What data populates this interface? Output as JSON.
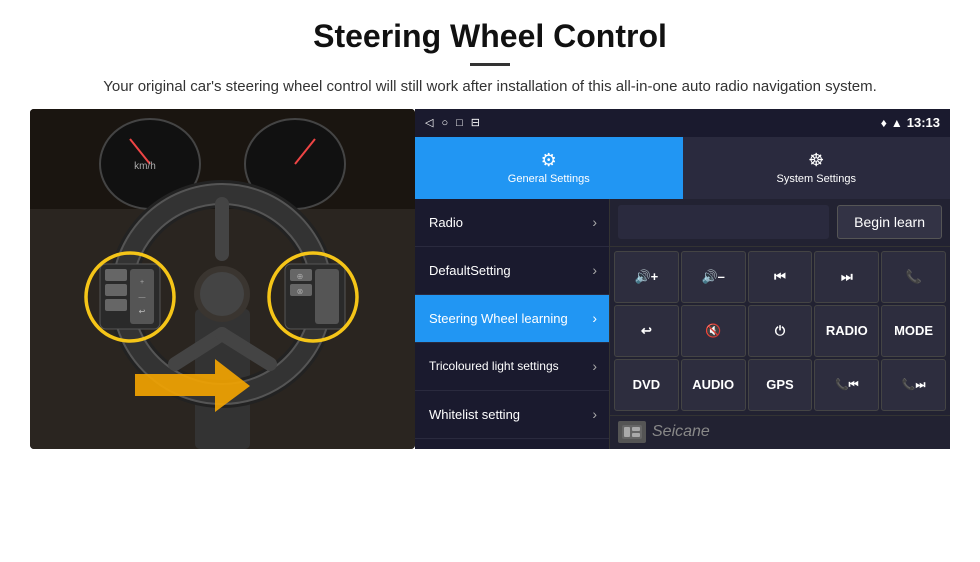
{
  "header": {
    "title": "Steering Wheel Control",
    "divider": "",
    "subtitle": "Your original car's steering wheel control will still work after installation of this all-in-one auto radio navigation system."
  },
  "statusbar": {
    "nav_back": "◁",
    "nav_home": "○",
    "nav_recents": "□",
    "nav_cast": "⊟",
    "location_icon": "♦",
    "signal_icon": "▲",
    "time": "13:13"
  },
  "tabs": {
    "general": {
      "icon": "⚙",
      "label": "General Settings"
    },
    "system": {
      "icon": "☸",
      "label": "System Settings"
    }
  },
  "menu": {
    "items": [
      {
        "label": "Radio",
        "active": false
      },
      {
        "label": "DefaultSetting",
        "active": false
      },
      {
        "label": "Steering Wheel learning",
        "active": true
      },
      {
        "label": "Tricoloured light settings",
        "active": false
      },
      {
        "label": "Whitelist setting",
        "active": false
      }
    ]
  },
  "controls": {
    "begin_learn_label": "Begin learn",
    "buttons_row1": [
      {
        "label": "🔊+",
        "id": "vol-up"
      },
      {
        "label": "🔊–",
        "id": "vol-down"
      },
      {
        "label": "⏮",
        "id": "prev"
      },
      {
        "label": "⏭",
        "id": "next"
      },
      {
        "label": "📞",
        "id": "call"
      }
    ],
    "buttons_row2": [
      {
        "label": "↩",
        "id": "hangup"
      },
      {
        "label": "🔇",
        "id": "mute"
      },
      {
        "label": "⏻",
        "id": "power"
      },
      {
        "label": "RADIO",
        "id": "radio-btn"
      },
      {
        "label": "MODE",
        "id": "mode"
      }
    ],
    "buttons_row3": [
      {
        "label": "DVD",
        "id": "dvd"
      },
      {
        "label": "AUDIO",
        "id": "audio"
      },
      {
        "label": "GPS",
        "id": "gps"
      },
      {
        "label": "📞⏮",
        "id": "tel-prev"
      },
      {
        "label": "📞⏭",
        "id": "tel-next"
      }
    ]
  },
  "watermark": {
    "text": "Seicane"
  }
}
